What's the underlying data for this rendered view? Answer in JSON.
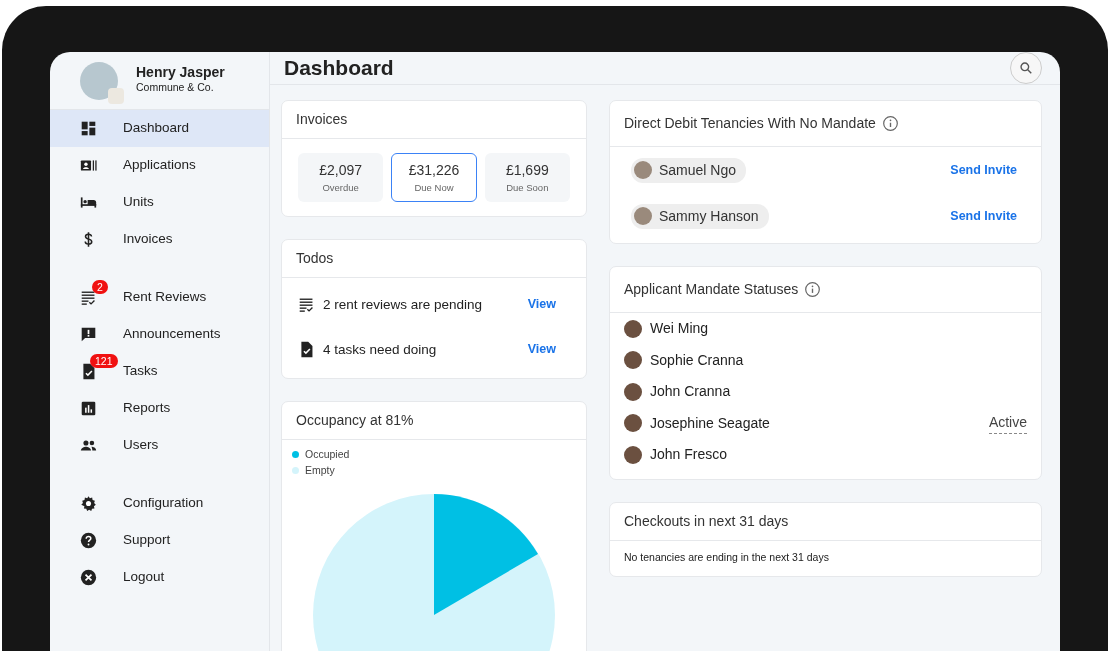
{
  "user": {
    "name": "Henry Jasper",
    "company": "Commune & Co."
  },
  "sidebar": {
    "groups": [
      [
        {
          "label": "Dashboard",
          "selected": true
        },
        {
          "label": "Applications",
          "selected": false
        },
        {
          "label": "Units",
          "selected": false
        },
        {
          "label": "Invoices",
          "selected": false
        }
      ],
      [
        {
          "label": "Rent Reviews",
          "selected": false,
          "badge": "2"
        },
        {
          "label": "Announcements",
          "selected": false
        },
        {
          "label": "Tasks",
          "selected": false,
          "badge": "121"
        },
        {
          "label": "Reports",
          "selected": false
        },
        {
          "label": "Users",
          "selected": false
        }
      ],
      [
        {
          "label": "Configuration",
          "selected": false
        },
        {
          "label": "Support",
          "selected": false
        },
        {
          "label": "Logout",
          "selected": false
        }
      ]
    ]
  },
  "page_title": "Dashboard",
  "invoices": {
    "title": "Invoices",
    "tiles": [
      {
        "amount": "£2,097",
        "label": "Overdue",
        "selected": false
      },
      {
        "amount": "£31,226",
        "label": "Due Now",
        "selected": true
      },
      {
        "amount": "£1,699",
        "label": "Due Soon",
        "selected": false
      }
    ]
  },
  "todos": {
    "title": "Todos",
    "items": [
      {
        "text": "2 rent reviews are pending",
        "link": "View"
      },
      {
        "text": "4 tasks need doing",
        "link": "View"
      }
    ]
  },
  "occupancy": {
    "title": "Occupancy at 81%",
    "legend": [
      {
        "label": "Occupied",
        "color": "#00c0e4"
      },
      {
        "label": "Empty",
        "color": "#d4f4fb"
      }
    ]
  },
  "no_mandate": {
    "title": "Direct Debit Tenancies With No Mandate",
    "rows": [
      {
        "name": "Samuel Ngo",
        "action": "Send Invite"
      },
      {
        "name": "Sammy Hanson",
        "action": "Send Invite"
      }
    ]
  },
  "mandate_statuses": {
    "title": "Applicant Mandate Statuses",
    "rows": [
      {
        "name": "Wei Ming"
      },
      {
        "name": "Sophie Cranna"
      },
      {
        "name": "John Cranna"
      },
      {
        "name": "Josephine Seagate",
        "status": "Active"
      },
      {
        "name": "John Fresco"
      }
    ]
  },
  "checkouts": {
    "title": "Checkouts in next 31 days",
    "message": "No tenancies are ending in the next 31 days"
  }
}
